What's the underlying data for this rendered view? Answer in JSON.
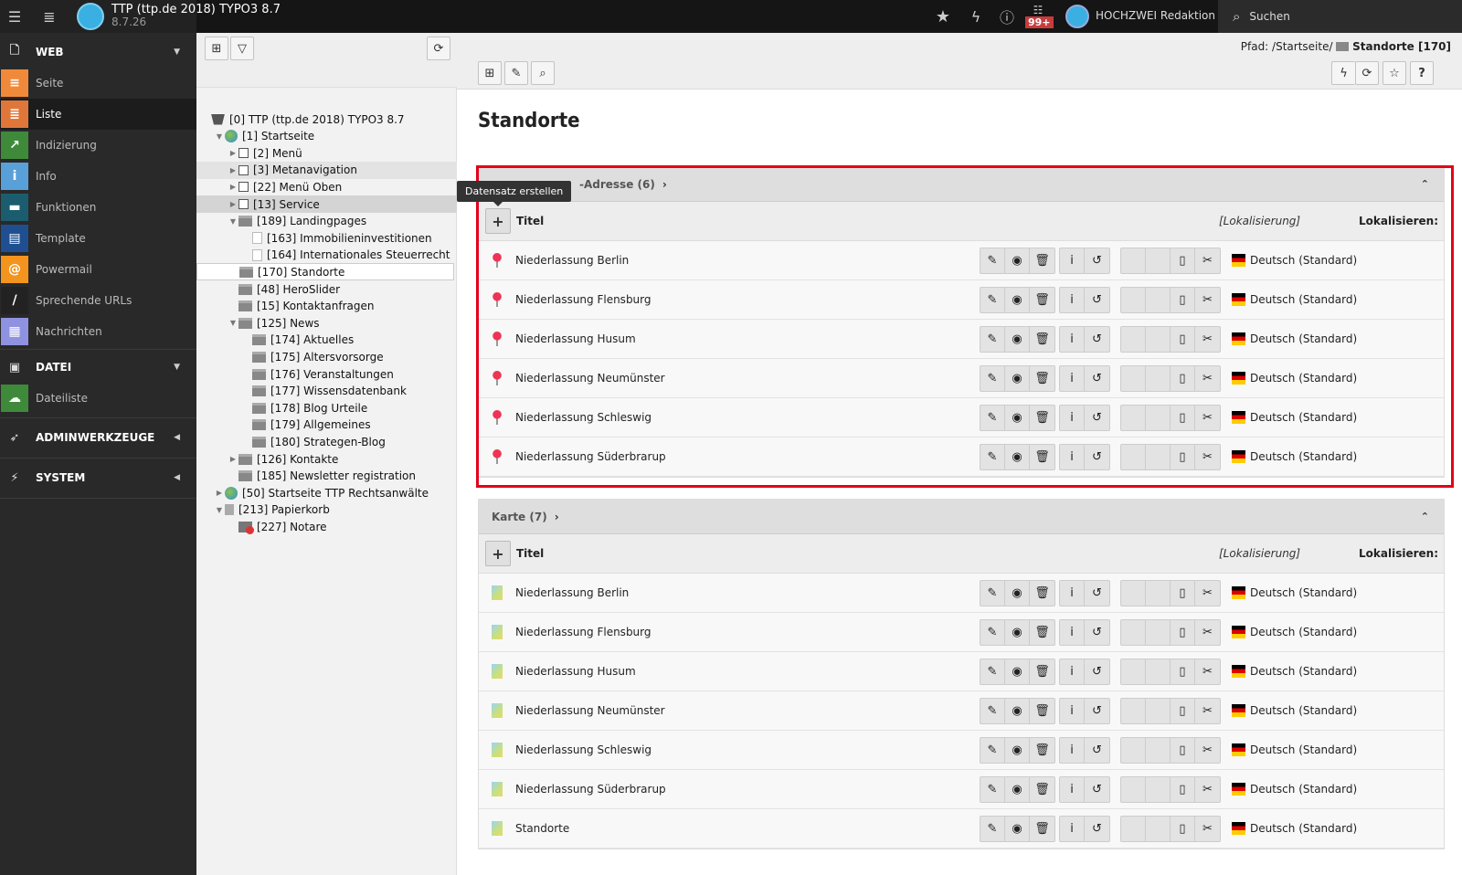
{
  "topbar": {
    "site_title": "TTP (ttp.de 2018) TYPO3 8.7",
    "site_version": "8.7.26",
    "notification_count": "99+",
    "user_name": "HOCHZWEI Redaktion",
    "search_label": "Suchen"
  },
  "sidebar": {
    "groups": [
      {
        "label": "WEB",
        "icon": "page-icon",
        "expanded": true
      },
      {
        "label": "DATEI",
        "icon": "image-icon",
        "expanded": true
      },
      {
        "label": "ADMINWERKZEUGE",
        "icon": "rocket-icon",
        "expanded": false
      },
      {
        "label": "SYSTEM",
        "icon": "plug-icon",
        "expanded": false
      }
    ],
    "items": [
      {
        "label": "Seite",
        "icon": "page-module-icon",
        "color": "#f08a3a"
      },
      {
        "label": "Liste",
        "icon": "list-module-icon",
        "color": "#e0773a",
        "active": true
      },
      {
        "label": "Indizierung",
        "icon": "indexing-icon",
        "color": "#3f8a3a"
      },
      {
        "label": "Info",
        "icon": "info-icon",
        "color": "#5aa0d8"
      },
      {
        "label": "Funktionen",
        "icon": "toolbox-icon",
        "color": "#1b5d6f"
      },
      {
        "label": "Template",
        "icon": "template-icon",
        "color": "#1f4f90"
      },
      {
        "label": "Powermail",
        "icon": "powermail-icon",
        "color": "#f3941e"
      },
      {
        "label": "Sprechende URLs",
        "icon": "pill-icon",
        "color": "#222222"
      },
      {
        "label": "Nachrichten",
        "icon": "news-icon",
        "color": "#8f92e0"
      },
      {
        "label": "Dateiliste",
        "icon": "filelist-icon",
        "color": "#3f8a3a"
      }
    ]
  },
  "tree": [
    {
      "label": "[0] TTP (ttp.de 2018) TYPO3 8.7",
      "level": 0,
      "icon": "typo3",
      "toggle": ""
    },
    {
      "label": "[1] Startseite",
      "level": 1,
      "icon": "globe",
      "toggle": "open"
    },
    {
      "label": "[2] Menü",
      "level": 2,
      "icon": "link",
      "toggle": "closed"
    },
    {
      "label": "[3] Metanavigation",
      "level": 2,
      "icon": "link",
      "toggle": "closed",
      "state": "hover"
    },
    {
      "label": "[22] Menü Oben",
      "level": 2,
      "icon": "link",
      "toggle": "closed"
    },
    {
      "label": "[13] Service",
      "level": 2,
      "icon": "link",
      "toggle": "closed",
      "state": "highlight"
    },
    {
      "label": "[189] Landingpages",
      "level": 2,
      "icon": "folder",
      "toggle": "open"
    },
    {
      "label": "[163] Immobilieninvestitionen",
      "level": 3,
      "icon": "page",
      "toggle": ""
    },
    {
      "label": "[164] Internationales Steuerrecht",
      "level": 3,
      "icon": "page",
      "toggle": ""
    },
    {
      "label": "[170] Standorte",
      "level": 2,
      "icon": "folder",
      "toggle": "",
      "state": "selected"
    },
    {
      "label": "[48] HeroSlider",
      "level": 2,
      "icon": "folder",
      "toggle": ""
    },
    {
      "label": "[15] Kontaktanfragen",
      "level": 2,
      "icon": "folder",
      "toggle": ""
    },
    {
      "label": "[125] News",
      "level": 2,
      "icon": "folder",
      "toggle": "open"
    },
    {
      "label": "[174] Aktuelles",
      "level": 3,
      "icon": "folder",
      "toggle": ""
    },
    {
      "label": "[175] Altersvorsorge",
      "level": 3,
      "icon": "folder",
      "toggle": ""
    },
    {
      "label": "[176] Veranstaltungen",
      "level": 3,
      "icon": "folder",
      "toggle": ""
    },
    {
      "label": "[177] Wissensdatenbank",
      "level": 3,
      "icon": "folder",
      "toggle": ""
    },
    {
      "label": "[178] Blog Urteile",
      "level": 3,
      "icon": "folder",
      "toggle": ""
    },
    {
      "label": "[179] Allgemeines",
      "level": 3,
      "icon": "folder",
      "toggle": ""
    },
    {
      "label": "[180] Strategen-Blog",
      "level": 3,
      "icon": "folder",
      "toggle": ""
    },
    {
      "label": "[126] Kontakte",
      "level": 2,
      "icon": "folder",
      "toggle": "closed"
    },
    {
      "label": "[185] Newsletter registration",
      "level": 2,
      "icon": "folder",
      "toggle": ""
    },
    {
      "label": "[50] Startseite TTP Rechtsanwälte",
      "level": 1,
      "icon": "globe",
      "toggle": "closed"
    },
    {
      "label": "[213] Papierkorb",
      "level": 1,
      "icon": "trash",
      "toggle": "open"
    },
    {
      "label": "[227] Notare",
      "level": 2,
      "icon": "deleted-folder",
      "toggle": ""
    }
  ],
  "main": {
    "path_prefix": "Pfad: /Startseite/",
    "path_current": "Standorte [170]",
    "page_title": "Standorte",
    "tooltip": "Datensatz erstellen",
    "col_title": "Titel",
    "col_localization": "[Lokalisierung]",
    "col_localize": "Lokalisieren:",
    "language": "Deutsch (Standard)",
    "highlight_color": "#e4001b",
    "sections": [
      {
        "title": "-Adresse (6)",
        "record_icon": "map-pin-icon",
        "records": [
          "Niederlassung Berlin",
          "Niederlassung Flensburg",
          "Niederlassung Husum",
          "Niederlassung Neumünster",
          "Niederlassung Schleswig",
          "Niederlassung Süderbrarup"
        ]
      },
      {
        "title": "Karte (7)",
        "record_icon": "map-icon",
        "records": [
          "Niederlassung Berlin",
          "Niederlassung Flensburg",
          "Niederlassung Husum",
          "Niederlassung Neumünster",
          "Niederlassung Schleswig",
          "Niederlassung Süderbrarup",
          "Standorte"
        ]
      }
    ]
  }
}
